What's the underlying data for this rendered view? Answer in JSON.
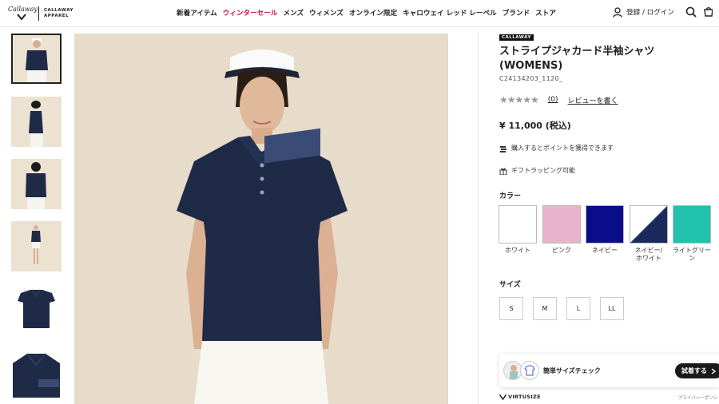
{
  "header": {
    "logo_script": "Callaway",
    "logo_line1": "CALLAWAY",
    "logo_line2": "APPAREL",
    "nav": [
      {
        "label": "新着アイテム",
        "highlight": false
      },
      {
        "label": "ウィンターセール",
        "highlight": true
      },
      {
        "label": "メンズ",
        "highlight": false
      },
      {
        "label": "ウィメンズ",
        "highlight": false
      },
      {
        "label": "オンライン限定",
        "highlight": false
      },
      {
        "label": "キャロウェイ レッド レーベル",
        "highlight": false
      },
      {
        "label": "ブランド",
        "highlight": false
      },
      {
        "label": "ストア",
        "highlight": false
      }
    ],
    "login_label": "登録 / ログイン",
    "icons": [
      "user-icon",
      "search-icon",
      "cart-icon"
    ]
  },
  "gallery": {
    "thumbnails": [
      "front-view",
      "side-view",
      "back-view",
      "full-body-view",
      "flat-front",
      "flat-detail"
    ],
    "active_index": 0
  },
  "product": {
    "brand_badge": "CALLAWAY",
    "title_line1": "ストライプジャカード半袖シャツ",
    "title_line2": "(WOMENS)",
    "sku": "C24134203_1120_",
    "stars": "★★★★★",
    "rating_value": 0,
    "review_count": "(0)",
    "review_link": "レビューを書く",
    "price": "¥ 11,000 (税込)",
    "points_text": "購入するとポイントを獲得できます",
    "gift_text": "ギフトラッピング可能"
  },
  "colors": {
    "label": "カラー",
    "options": [
      {
        "label_line1": "ホワイト",
        "label_line2": "",
        "hex": "#ffffff"
      },
      {
        "label_line1": "ピンク",
        "label_line2": "",
        "hex": "#e8b4cc"
      },
      {
        "label_line1": "ネイビー",
        "label_line2": "",
        "hex": "#0a0d8a"
      },
      {
        "label_line1": "ネイビー/",
        "label_line2": "ホワイト",
        "hex": "#1a2a5c"
      },
      {
        "label_line1": "ライトグリー",
        "label_line2": "ン",
        "hex": "#22c1ac"
      }
    ]
  },
  "sizes": {
    "label": "サイズ",
    "options": [
      "S",
      "M",
      "L",
      "LL"
    ]
  },
  "virtusize": {
    "label": "簡単サイズチェック",
    "try_button": "試着する",
    "logo": "VIRTUSIZE",
    "privacy": "プライバシーポリシ"
  },
  "colors_theme": {
    "accent_sale": "#c8104e",
    "navy_shirt": "#1f2a47",
    "background_photo": "#e6dcc9"
  }
}
